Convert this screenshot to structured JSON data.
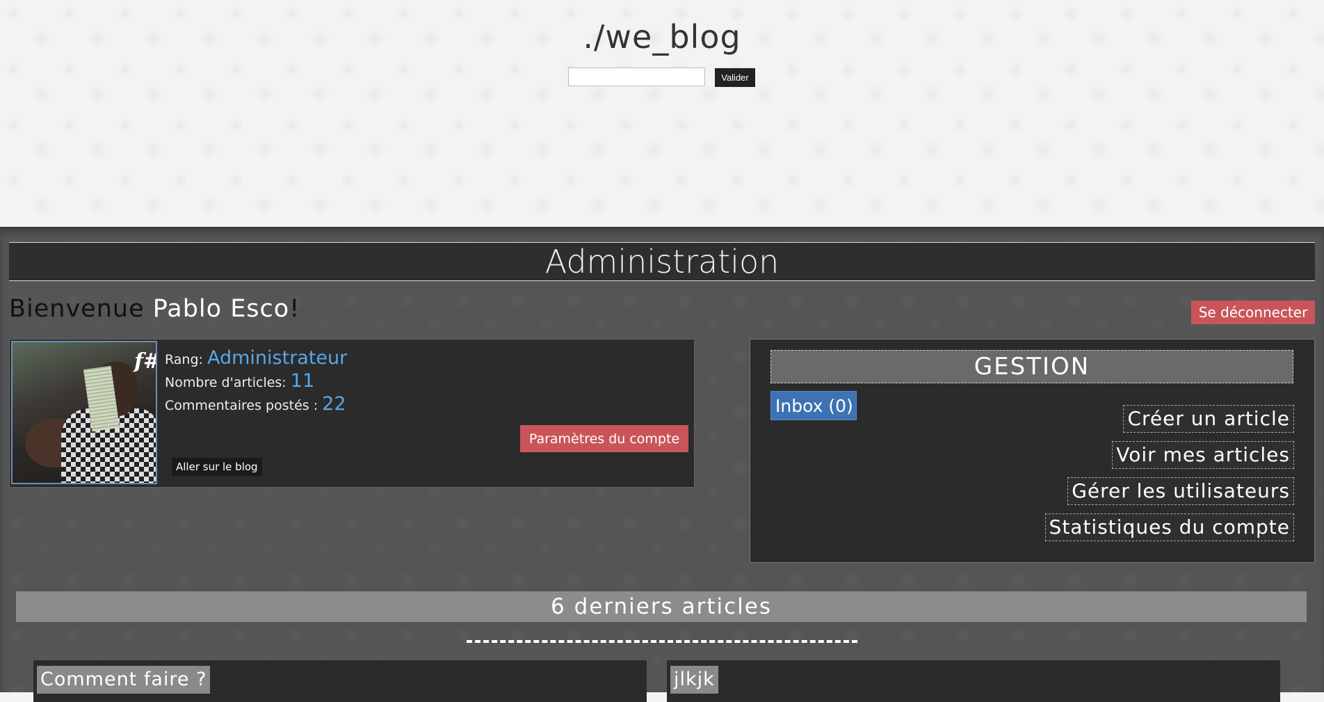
{
  "header": {
    "site_title": "./we_blog",
    "search_placeholder": "",
    "search_value": "",
    "search_button": "Valider"
  },
  "admin": {
    "title": "Administration",
    "welcome_prefix": "Bienvenue ",
    "user_name": "Pablo Esco",
    "welcome_suffix": "!",
    "logout_label": "Se déconnecter"
  },
  "profile": {
    "avatar_badge": "f#",
    "rank_label": "Rang: ",
    "rank_value": "Administrateur",
    "articles_label": "Nombre d'articles: ",
    "articles_value": "11",
    "comments_label": "Commentaires postés : ",
    "comments_value": "22",
    "settings_label": "Paramètres du compte",
    "goto_blog_label": "Aller sur le blog"
  },
  "gestion": {
    "title": "GESTION",
    "inbox_label": "Inbox (0)",
    "links": {
      "create": "Créer un article",
      "view": "Voir mes articles",
      "users": "Gérer les utilisateurs",
      "stats": "Statistiques du compte"
    }
  },
  "latest": {
    "title": "6 derniers articles",
    "articles": [
      {
        "title": "Comment faire ?"
      },
      {
        "title": "jlkjk"
      }
    ]
  },
  "colors": {
    "accent_blue": "#5aa6e8",
    "danger_red": "#c9555a",
    "inbox_blue": "#3d72b3"
  }
}
